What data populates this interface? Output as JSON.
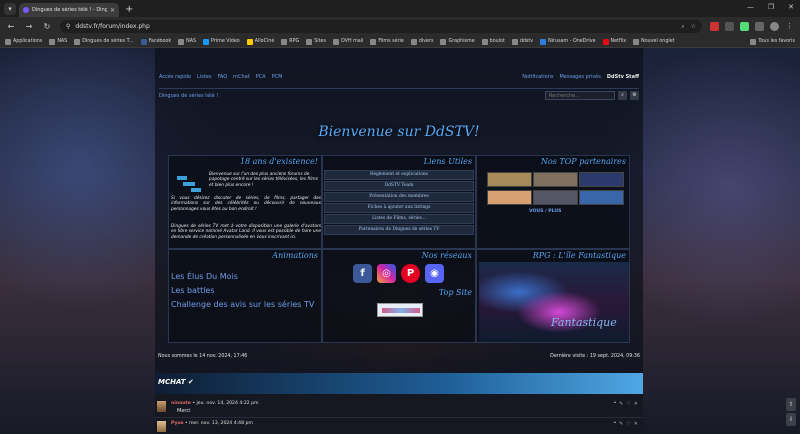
{
  "browser": {
    "tab_title": "Dingues de séries télé ! - Dingu...",
    "address": "ddstv.fr/forum/index.php",
    "bookmarks": [
      "Applications",
      "NAS",
      "Dingues de séries T...",
      "Facebook",
      "NAS",
      "Prime Video",
      "AlloCiné",
      "RPG",
      "Sites",
      "OVH mail",
      "Films série",
      "divers",
      "Graphisme",
      "boulot",
      "ddstv",
      "Nirusam - OneDrive",
      "Netflix",
      "Nouvel onglet"
    ],
    "all_bookmarks": "Tous les favoris"
  },
  "topnav": {
    "quick_access": "Accès rapide",
    "lists": "Listes",
    "faq": "FAQ",
    "mchat": "mChat",
    "pca": "PCA",
    "pcm": "PCM",
    "notifications": "Notifications",
    "private_messages": "Messages privés",
    "user": "DdStv Staff"
  },
  "breadcrumb": "Dingues de séries télé !",
  "search": {
    "placeholder": "Recherche…"
  },
  "welcome": "Bienvenue sur DdSTV!",
  "panels": {
    "years": "18 ans d'existence!",
    "intro_a": "Bienvenue sur l'un des plus anciens forums de papotage centré sur les séries télévisées, les films et bien plus encore !",
    "intro_b": "Si vous désirez discuter de séries, de films, partager des informations sur des célébrités ou découvrir de nouveaux personnages vous êtes au bon endroit !",
    "intro_c": "Dingues de séries TV met à votre disposition une galerie d'avatars en libre service nommé Avatar Land. Il vous est possible de faire une demande de création personnalisée en vous inscrivant ici.",
    "useful_links": "Liens Utiles",
    "links": [
      "Règlement et explications",
      "DdSTV Team",
      "Présentation des membres",
      "Fiches à ajouter aux listings",
      "Listes de Films, séries...",
      "Partenaires de Dingues de séries TV"
    ],
    "top_partners": "Nos TOP partenaires",
    "partners_more": "VOUS / PLUS",
    "animations": "Animations",
    "anim_items": [
      "Les Élus Du Mois",
      "Les battles",
      "Challenge des avis sur les séries TV"
    ],
    "networks": "Nos réseaux",
    "top_site": "Top Site",
    "rpg": "RPG : L'île Fantastique",
    "rpg_image_text": "Fantastique"
  },
  "status": {
    "now": "Nous sommes le 14 nov. 2024, 17:46",
    "last_visit": "Dernière visite : 19 sept. 2024, 09:36"
  },
  "mchat": {
    "title": "MCHAT ✔",
    "messages": [
      {
        "user": "ninoute",
        "date": " • jeu. nov. 14, 2024 4:22 pm",
        "text": "Merci"
      },
      {
        "user": "Pyus",
        "date": " • mer. nov. 13, 2024 4:48 pm",
        "text": ""
      }
    ]
  }
}
